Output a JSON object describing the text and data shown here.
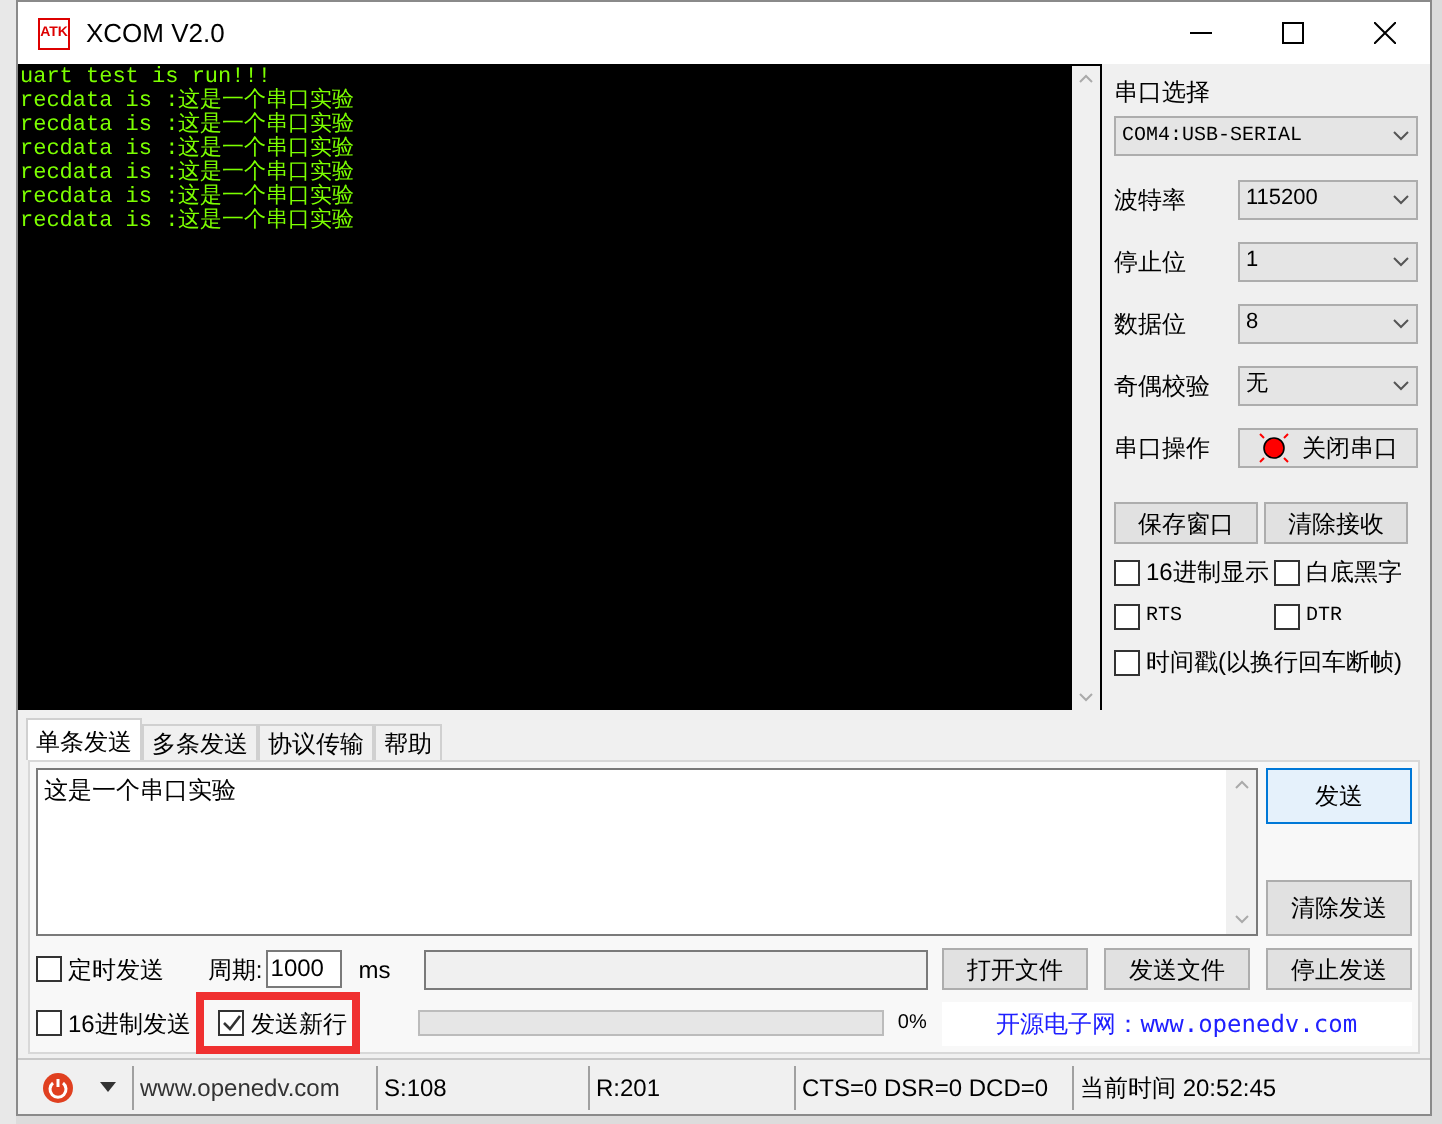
{
  "window": {
    "title": "XCOM V2.0",
    "logo": "ATK"
  },
  "terminal": {
    "lines": [
      "uart test is run!!!",
      "recdata is :这是一个串口实验",
      "recdata is :这是一个串口实验",
      "recdata is :这是一个串口实验",
      "recdata is :这是一个串口实验",
      "recdata is :这是一个串口实验",
      "recdata is :这是一个串口实验"
    ]
  },
  "port_select": {
    "label": "串口选择",
    "value": "COM4:USB-SERIAL"
  },
  "settings": [
    {
      "label": "波特率",
      "value": "115200"
    },
    {
      "label": "停止位",
      "value": "1"
    },
    {
      "label": "数据位",
      "value": "8"
    },
    {
      "label": "奇偶校验",
      "value": "无"
    }
  ],
  "port_operation": {
    "label": "串口操作",
    "button": "关闭串口",
    "open": true
  },
  "receive_buttons": [
    "保存窗口",
    "清除接收"
  ],
  "receive_options": [
    {
      "label": "16进制显示",
      "checked": false
    },
    {
      "label": "白底黑字",
      "checked": false
    },
    {
      "label": "RTS",
      "checked": false
    },
    {
      "label": "DTR",
      "checked": false
    },
    {
      "label": "时间戳(以换行回车断帧)",
      "checked": false
    }
  ],
  "tabs": [
    {
      "label": "单条发送",
      "selected": true
    },
    {
      "label": "多条发送",
      "selected": false
    },
    {
      "label": "协议传输",
      "selected": false
    },
    {
      "label": "帮助",
      "selected": false
    }
  ],
  "send_text": "这是一个串口实验",
  "send_buttons": [
    "发送",
    "清除发送"
  ],
  "timed_send": {
    "label": "定时发送",
    "checked": false,
    "period_label": "周期:",
    "period": "1000",
    "unit": "ms"
  },
  "hex_send": {
    "label": "16进制发送",
    "checked": false
  },
  "send_newline": {
    "label": "发送新行",
    "checked": true
  },
  "file_buttons": [
    "打开文件",
    "发送文件",
    "停止发送"
  ],
  "progress": {
    "level": 0,
    "reading": "0%"
  },
  "banner": "开源电子网：www.openedv.com",
  "status_bar": {
    "website": "www.openedv.com",
    "sent": "S:108",
    "received": "R:201",
    "signals": "CTS=0 DSR=0 DCD=0",
    "time": "当前时间 20:52:45"
  }
}
